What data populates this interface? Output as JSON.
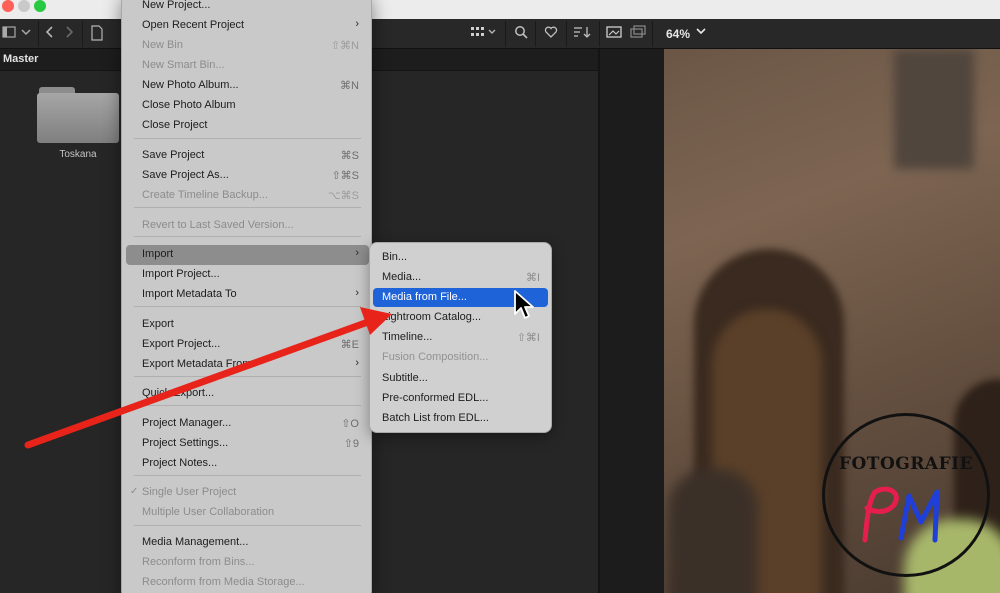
{
  "titlebar": {},
  "toolbar": {
    "zoom_level": "64%",
    "zoom_chevron": "⌄",
    "icons": [
      "sidebar-icon",
      "chevron-down-icon",
      "back-icon",
      "forward-icon",
      "document-icon",
      "grid-view-icon",
      "search-icon",
      "favorite-icon",
      "sort-icon",
      "image-view-icon",
      "overlay-icon"
    ]
  },
  "left_panel": {
    "master_label": "Master",
    "folder_label": "Toskana"
  },
  "menu": {
    "items": [
      {
        "label": "New Project...",
        "shortcut": ""
      },
      {
        "label": "Open Recent Project",
        "shortcut": "",
        "submenu": true
      },
      {
        "label": "New Bin",
        "shortcut": "⇧⌘N",
        "disabled": true
      },
      {
        "label": "New Smart Bin...",
        "shortcut": "",
        "disabled": true
      },
      {
        "label": "New Photo Album...",
        "shortcut": "⌘N"
      },
      {
        "label": "Close Photo Album",
        "shortcut": ""
      },
      {
        "label": "Close Project",
        "shortcut": ""
      },
      {
        "label": "Save Project",
        "shortcut": "⌘S"
      },
      {
        "label": "Save Project As...",
        "shortcut": "⇧⌘S"
      },
      {
        "label": "Create Timeline Backup...",
        "shortcut": "⌥⌘S",
        "disabled": true
      },
      {
        "label": "Revert to Last Saved Version...",
        "shortcut": "",
        "disabled": true
      },
      {
        "label": "Import",
        "shortcut": "",
        "submenu": true,
        "active": true
      },
      {
        "label": "Import Project...",
        "shortcut": ""
      },
      {
        "label": "Import Metadata To",
        "shortcut": "",
        "submenu": true
      },
      {
        "label": "Export",
        "shortcut": ""
      },
      {
        "label": "Export Project...",
        "shortcut": "⌘E"
      },
      {
        "label": "Export Metadata From",
        "shortcut": "",
        "submenu": true
      },
      {
        "label": "Quick Export...",
        "shortcut": ""
      },
      {
        "label": "Project Manager...",
        "shortcut": "⇧O"
      },
      {
        "label": "Project Settings...",
        "shortcut": "⇧9"
      },
      {
        "label": "Project Notes...",
        "shortcut": ""
      },
      {
        "label": "Single User Project",
        "shortcut": "",
        "disabled": true,
        "checked": true
      },
      {
        "label": "Multiple User Collaboration",
        "shortcut": "",
        "disabled": true
      },
      {
        "label": "Media Management...",
        "shortcut": ""
      },
      {
        "label": "Reconform from Bins...",
        "shortcut": "",
        "disabled": true
      },
      {
        "label": "Reconform from Media Storage...",
        "shortcut": "",
        "disabled": true
      }
    ],
    "check_mark": "✓",
    "submenu_arrow": "›"
  },
  "submenu": {
    "items": [
      {
        "label": "Bin...",
        "shortcut": ""
      },
      {
        "label": "Media...",
        "shortcut": "⌘I"
      },
      {
        "label": "Media from File...",
        "shortcut": "",
        "highlight": true
      },
      {
        "label": "Lightroom Catalog...",
        "shortcut": ""
      },
      {
        "label": "Timeline...",
        "shortcut": "⇧⌘I"
      },
      {
        "label": "Fusion Composition...",
        "shortcut": "",
        "disabled": true
      },
      {
        "label": "Subtitle...",
        "shortcut": ""
      },
      {
        "label": "Pre-conformed EDL...",
        "shortcut": ""
      },
      {
        "label": "Batch List from EDL...",
        "shortcut": ""
      }
    ]
  },
  "watermark": {
    "text": "FOTOGRAFIE",
    "signature": "PM"
  },
  "colors": {
    "highlight": "#1f63d8",
    "annotation_arrow": "#e8231a",
    "menu_bg": "#c9c9c9"
  }
}
